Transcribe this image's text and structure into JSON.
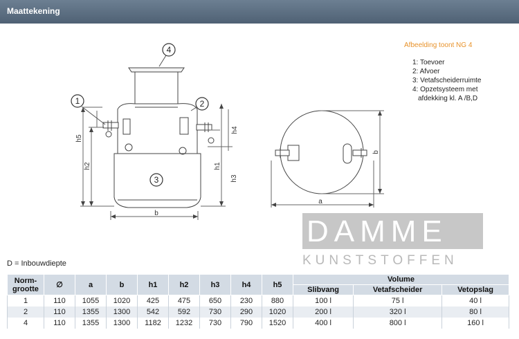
{
  "header": {
    "title": "Maattekening"
  },
  "caption": "Afbeelding toont NG 4",
  "legend": [
    {
      "text": "1: Toevoer"
    },
    {
      "text": "2: Afvoer"
    },
    {
      "text": "3: Vetafscheiderruimte"
    },
    {
      "text": "4: Opzetsysteem met"
    },
    {
      "text": "afdekking kl. A /B,D"
    }
  ],
  "drawing": {
    "callouts": [
      "1",
      "2",
      "3",
      "4"
    ],
    "dims": {
      "h5": "h5",
      "h2": "h2",
      "h4": "h4",
      "h1": "h1",
      "h3": "h3",
      "b": "b",
      "a": "a",
      "b_side": "b"
    }
  },
  "logo": {
    "top": "DAMME",
    "bottom": "KUNSTSTOFFEN"
  },
  "dnote": "D = Inbouwdiepte",
  "table": {
    "headers": {
      "norm": "Norm-grootte",
      "norm_line1": "Norm-",
      "norm_line2": "grootte",
      "diam": "∅",
      "a": "a",
      "b": "b",
      "h1": "h1",
      "h2": "h2",
      "h3": "h3",
      "h4": "h4",
      "h5": "h5",
      "volume": "Volume",
      "slibvang": "Slibvang",
      "vetafscheider": "Vetafscheider",
      "vetopslag": "Vetopslag"
    },
    "rows": [
      {
        "ng": "1",
        "diam": "110",
        "a": "1055",
        "b": "1020",
        "h1": "425",
        "h2": "475",
        "h3": "650",
        "h4": "230",
        "h5": "880",
        "slibvang": "100 l",
        "vetafscheider": "75 l",
        "vetopslag": "40 l"
      },
      {
        "ng": "2",
        "diam": "110",
        "a": "1355",
        "b": "1300",
        "h1": "542",
        "h2": "592",
        "h3": "730",
        "h4": "290",
        "h5": "1020",
        "slibvang": "200 l",
        "vetafscheider": "320 l",
        "vetopslag": "80 l"
      },
      {
        "ng": "4",
        "diam": "110",
        "a": "1355",
        "b": "1300",
        "h1": "1182",
        "h2": "1232",
        "h3": "730",
        "h4": "790",
        "h5": "1520",
        "slibvang": "400 l",
        "vetafscheider": "800 l",
        "vetopslag": "160 l"
      }
    ]
  }
}
